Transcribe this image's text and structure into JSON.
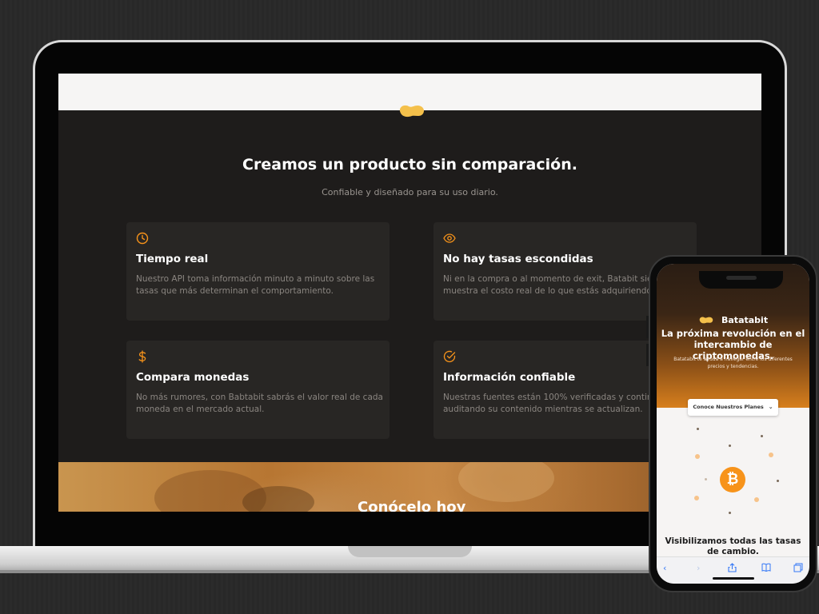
{
  "laptop": {
    "section_title": "Creamos un producto sin comparación.",
    "section_subtitle": "Confiable y diseñado para su uso diario.",
    "features": [
      {
        "icon": "clock-icon",
        "title": "Tiempo real",
        "text": "Nuestro API toma información minuto a minuto sobre las tasas que más determinan el comportamiento."
      },
      {
        "icon": "eye-icon",
        "title": "No hay tasas escondidas",
        "text": "Ni en la compra o al momento de exit, Batabit siempre te muestra el costo real de lo que estás adquiriendo."
      },
      {
        "icon": "dollar-icon",
        "title": "Compara monedas",
        "text": "No más rumores, con Babtabit sabrás el valor real de cada moneda en el mercado actual."
      },
      {
        "icon": "check-circle-icon",
        "title": "Información confiable",
        "text": "Nuestras fuentes están 100% verificadas y continuamos auditando su contenido mientras se actualizan."
      }
    ],
    "hero_text": "Conócelo hoy"
  },
  "phone": {
    "brand": "Batatabit",
    "headline": "La próxima revolución en el intercambio de criptomonedas.",
    "subtitle": "Batatabit te ayuda a navegar entre los diferentes precios y tendencias.",
    "cta_button": "Conoce Nuestros Planes",
    "bottom_title": "Visibilizamos todas las tasas de cambio.",
    "toolbar": [
      "back-icon",
      "forward-icon",
      "share-icon",
      "bookmarks-icon",
      "tabs-icon"
    ]
  },
  "colors": {
    "accent": "#f7931a",
    "brand_yellow": "#f4c04b",
    "dark_bg": "#1e1c1b",
    "card_bg": "#282624"
  }
}
